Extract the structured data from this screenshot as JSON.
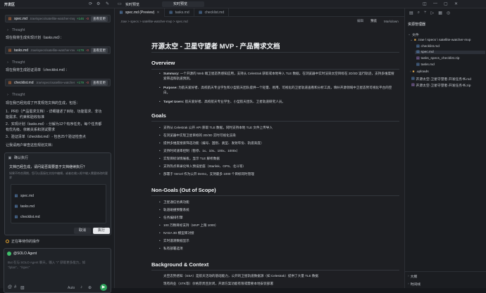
{
  "titlebar": {
    "left_title": "开发区",
    "center_title": "实时预览"
  },
  "cards": [
    {
      "name": "spec.md",
      "path": ".trae\\specs\\satellite-watcher-mvp\\",
      "plus": "+146",
      "minus": "-0",
      "btn": "查看变更"
    },
    {
      "name": "tasks.md",
      "path": ".trae\\specs\\satellite-watcher-mvp\\",
      "plus": "+179",
      "minus": "-0",
      "btn": "查看变更"
    },
    {
      "name": "checklist.md",
      "path": ".trae\\specs\\satellite-watcher-mvp\\",
      "plus": "+179",
      "minus": "-0",
      "btn": "查看变更"
    }
  ],
  "thought": "Thought",
  "left_texts": {
    "t1": "现在我将生成实现计划（tasks.md）：",
    "t2": "现在我将生成验证清单（checklist.md）：",
    "t3": "现在我已经完成了开发规范文档的生成，包括：",
    "l1a": "1．PRD（产品需求文档）- 详细描述了目标、功能需求、非功",
    "l1b": "    能需求、约束和验收标准",
    "l2a": "2．实现计划（tasks.md）- 分解为12个有序任务，每个任务都",
    "l2b": "    有优先级、依赖关系和测试要求",
    "l3": "3．验证清单（checklist.md）- 包含25个验证检查点",
    "t4": "让我请用户审查这些规划文档："
  },
  "dialog": {
    "title": "确认执行",
    "q": "文档已经生成，请问是否需要基于文档继续执行？",
    "desc": "如果不符合预期，您可以直接在文档中编辑，或者在输入框中输入需要修改的要求",
    "files": [
      "spec.md",
      "tasks.md",
      "checklist.md"
    ],
    "cancel": "取消",
    "run": "执行"
  },
  "waiting": "正在等待你的操作",
  "agent": {
    "name": "@SOLO Agent",
    "placeholder": "But 在与 SOLO Agent 聊天，输入 \"/\" 获取更多能力，如 \"/plan\"、\"/spec\"",
    "mode": "Auto"
  },
  "tabs": [
    {
      "label": "spec.md (Preview)",
      "active": true
    },
    {
      "label": "tasks.md",
      "active": false
    },
    {
      "label": "checklist.md",
      "active": false
    }
  ],
  "breadcrumb": ".trae  >  specs  >  satellite-watcher-mvp  >  spec.md",
  "editor_actions": [
    "编辑",
    "预览",
    "Markdown"
  ],
  "doc": {
    "h1": "开源太空 - 卫星守望者 MVP - 产品需求文档",
    "overview_h": "Overview",
    "overview": [
      {
        "k": "Summary:",
        "v": "一个开源的 Web 端卫星态势感知应用，支持从 Celestrak 获取或本地导入 TLE 数据，在浏览器中实时渲染太空目标在 2D/3D 运行轨迹，支持多维度搜索筛选和轨道预测。"
      },
      {
        "k": "Purpose:",
        "v": "为航天爱好者、高校航天专业学生和小型航天团队提供一个轻量、易用、可视化的卫星轨道查看和分析工具，填补开源领域中卫星态势可视化平台的空白。"
      },
      {
        "k": "Target Users:",
        "v": "航天爱好者、高校航天专业学生、小型航天团队、卫星轨道研究人员。"
      }
    ],
    "goals_h": "Goals",
    "goals": [
      "支持从 Celestrak 公开 API 获取 TLE 数据，同时支持本地 TLE 文件上传导入",
      "在浏览器中实现卫星目标的 2D/3D 实时可视化渲染",
      "提供多维度搜索筛选功能（编号、国别、类型、发射年份、轨道高度）",
      "支持时间速率控制（暂停、1x、10x、100x、1000x）",
      "实现目标详情展板，显示 TLE 解析数据",
      "支持热点目录化导入预设星座（Starlink、GPS、北斗等）",
      "部署于 Vercel 作为公开 Demo，支持最多 1000 个目标同时管理"
    ],
    "nongoals_h": "Non-Goals (Out of Scope)",
    "nongoals": [
      "卫星通信仿真功能",
      "轨道碰撞预警系统",
      "任务编排引擎",
      "100 万颗目标支持（MVP 上限 1000）",
      "NASA 3D 模型库对接",
      "实时遥测数据显示",
      "私有部署选项"
    ],
    "bg_h": "Background & Context",
    "bg": [
      "太空态势感知（SSA）是航天活动的基础能力，公开的卫星轨道数据源（如 Celestrak）提供了大量 TLE 数据",
      "现有商业（STK等）价格昂贵且封闭，开源方案功能有限或需要本地安装部署"
    ]
  },
  "explorer": {
    "title": "资源管理器",
    "section": "文件",
    "items": [
      {
        "label": ".trae \\ specs \\ satellite-watcher-mvp",
        "indent": 1,
        "folder": true
      },
      {
        "label": "checklist.md",
        "indent": 2
      },
      {
        "label": "spec.md",
        "indent": 2,
        "active": true
      },
      {
        "label": "tasks_specs_checklist.zip",
        "indent": 2
      },
      {
        "label": "tasks.md",
        "indent": 2
      },
      {
        "label": ".uploads",
        "indent": 1,
        "folder": true
      },
      {
        "label": "开源太空-卫星守望者-开发任务书.md",
        "indent": 1
      },
      {
        "label": "开源太空-卫星守望者-开发任务书.zip",
        "indent": 1
      }
    ],
    "outline": "大纲",
    "timeline": "时间线"
  }
}
